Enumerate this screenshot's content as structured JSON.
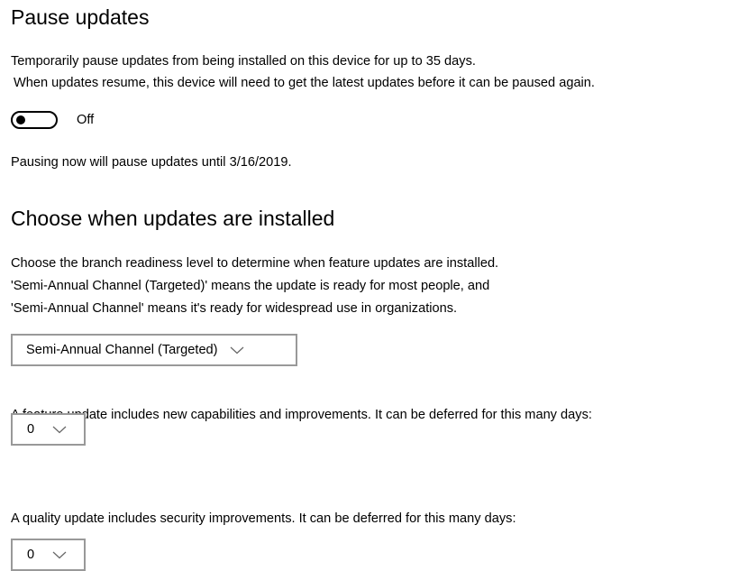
{
  "pause_updates": {
    "heading": "Pause updates",
    "description_line1": "Temporarily pause updates from being installed on this device for up to 35 days.",
    "description_line2": "When updates resume, this device will need to get the latest updates before it can be paused again.",
    "toggle_state_label": "Off",
    "toggle_on": false,
    "pause_until_text": "Pausing now will pause updates until 3/16/2019."
  },
  "choose_when": {
    "heading": "Choose when updates are installed",
    "description_line1": "Choose the branch readiness level to determine when feature updates are installed.",
    "description_line2": "'Semi-Annual Channel (Targeted)' means the update is ready for most people, and",
    "description_line3": "'Semi-Annual Channel' means it's ready for widespread use in organizations.",
    "branch_selected": "Semi-Annual Channel (Targeted)",
    "feature_update_text": "A feature update includes new capabilities and improvements. It can be deferred for this many days:",
    "feature_defer_days": "0",
    "quality_update_text": "A quality update includes security improvements. It can be deferred for this many days:",
    "quality_defer_days": "0"
  },
  "icons": {
    "dropdown": "chevron-down-icon"
  },
  "colors": {
    "text": "#000000",
    "dropdown_border": "#999999",
    "chevron": "#666666",
    "background": "#ffffff"
  }
}
